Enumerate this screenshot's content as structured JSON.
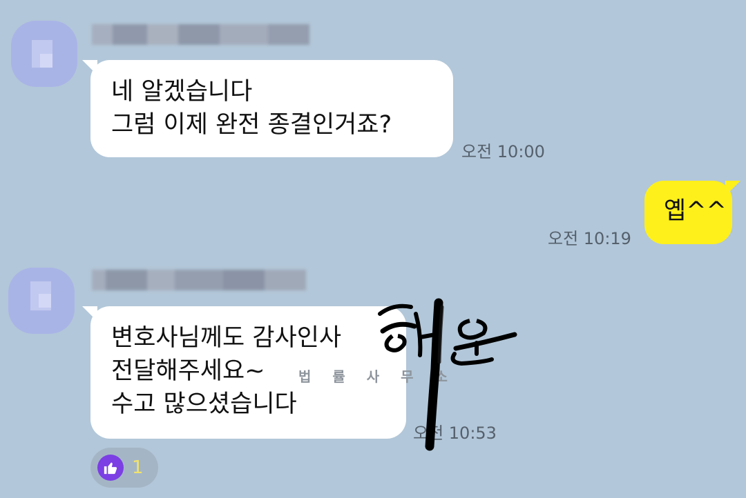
{
  "messages": [
    {
      "direction": "incoming",
      "lines": [
        "네 알겠습니다",
        "그럼 이제 완전 종결인거죠?"
      ],
      "time": "오전 10:00"
    },
    {
      "direction": "outgoing",
      "lines": [
        "옙^^"
      ],
      "time": "오전 10:19"
    },
    {
      "direction": "incoming",
      "lines": [
        "변호사님께도 감사인사",
        "전달해주세요~",
        "수고 많으셨습니다"
      ],
      "time": "오전 10:53"
    }
  ],
  "reaction": {
    "icon": "thumbs-up-icon",
    "count": "1",
    "color": "#7b3fe4"
  },
  "watermark": {
    "text": "법 률 사 무 소",
    "logo_text": "해온"
  },
  "colors": {
    "background": "#b2c7d9",
    "incoming_bubble": "#ffffff",
    "outgoing_bubble": "#fef01b"
  }
}
